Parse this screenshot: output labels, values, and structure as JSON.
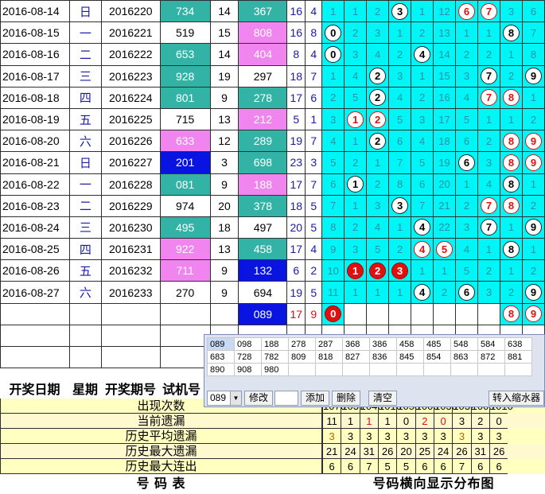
{
  "rows": [
    {
      "date": "2016-08-14",
      "week": "日",
      "issue": "2016220",
      "trial": "734",
      "trial_style": "teal",
      "span": "14",
      "prize": "367",
      "prize_style": "teal",
      "sum": "16",
      "pw": "4",
      "cells": [
        {
          "t": "1"
        },
        {
          "t": "1"
        },
        {
          "t": "2"
        },
        {
          "t": "3",
          "b": "black"
        },
        {
          "t": "1"
        },
        {
          "t": "12"
        },
        {
          "t": "6",
          "b": "red"
        },
        {
          "t": "7",
          "b": "red"
        },
        {
          "t": "3"
        },
        {
          "t": "6"
        }
      ]
    },
    {
      "date": "2016-08-15",
      "week": "一",
      "issue": "2016221",
      "trial": "519",
      "trial_style": "",
      "span": "15",
      "prize": "808",
      "prize_style": "pink",
      "sum": "16",
      "pw": "8",
      "cells": [
        {
          "t": "0",
          "b": "black"
        },
        {
          "t": "2"
        },
        {
          "t": "3"
        },
        {
          "t": "1"
        },
        {
          "t": "2"
        },
        {
          "t": "13"
        },
        {
          "t": "1"
        },
        {
          "t": "1"
        },
        {
          "t": "8",
          "b": "black"
        },
        {
          "t": "7"
        }
      ]
    },
    {
      "date": "2016-08-16",
      "week": "二",
      "issue": "2016222",
      "trial": "653",
      "trial_style": "teal",
      "span": "14",
      "prize": "404",
      "prize_style": "pink",
      "sum": "8",
      "pw": "4",
      "cells": [
        {
          "t": "0",
          "b": "black"
        },
        {
          "t": "3"
        },
        {
          "t": "4"
        },
        {
          "t": "2"
        },
        {
          "t": "4",
          "b": "black"
        },
        {
          "t": "14"
        },
        {
          "t": "2"
        },
        {
          "t": "2"
        },
        {
          "t": "1"
        },
        {
          "t": "8"
        }
      ]
    },
    {
      "date": "2016-08-17",
      "week": "三",
      "issue": "2016223",
      "trial": "928",
      "trial_style": "teal",
      "span": "19",
      "prize": "297",
      "prize_style": "",
      "sum": "18",
      "pw": "7",
      "cells": [
        {
          "t": "1"
        },
        {
          "t": "4"
        },
        {
          "t": "2",
          "b": "black"
        },
        {
          "t": "3"
        },
        {
          "t": "1"
        },
        {
          "t": "15"
        },
        {
          "t": "3"
        },
        {
          "t": "7",
          "b": "black"
        },
        {
          "t": "2"
        },
        {
          "t": "9",
          "b": "black"
        }
      ]
    },
    {
      "date": "2016-08-18",
      "week": "四",
      "issue": "2016224",
      "trial": "801",
      "trial_style": "teal",
      "span": "9",
      "prize": "278",
      "prize_style": "teal",
      "sum": "17",
      "pw": "6",
      "cells": [
        {
          "t": "2"
        },
        {
          "t": "5"
        },
        {
          "t": "2",
          "b": "black"
        },
        {
          "t": "4"
        },
        {
          "t": "2"
        },
        {
          "t": "16"
        },
        {
          "t": "4"
        },
        {
          "t": "7",
          "b": "red"
        },
        {
          "t": "8",
          "b": "red"
        },
        {
          "t": "1"
        }
      ]
    },
    {
      "date": "2016-08-19",
      "week": "五",
      "issue": "2016225",
      "trial": "715",
      "trial_style": "",
      "span": "13",
      "prize": "212",
      "prize_style": "pink",
      "sum": "5",
      "pw": "1",
      "cells": [
        {
          "t": "3"
        },
        {
          "t": "1",
          "b": "red"
        },
        {
          "t": "2",
          "b": "red"
        },
        {
          "t": "5"
        },
        {
          "t": "3"
        },
        {
          "t": "17"
        },
        {
          "t": "5"
        },
        {
          "t": "1"
        },
        {
          "t": "1"
        },
        {
          "t": "2"
        }
      ]
    },
    {
      "date": "2016-08-20",
      "week": "六",
      "issue": "2016226",
      "trial": "633",
      "trial_style": "pink",
      "span": "12",
      "prize": "289",
      "prize_style": "teal",
      "sum": "19",
      "pw": "7",
      "cells": [
        {
          "t": "4"
        },
        {
          "t": "1"
        },
        {
          "t": "2",
          "b": "black"
        },
        {
          "t": "6"
        },
        {
          "t": "4"
        },
        {
          "t": "18"
        },
        {
          "t": "6"
        },
        {
          "t": "2"
        },
        {
          "t": "8",
          "b": "red"
        },
        {
          "t": "9",
          "b": "red"
        }
      ]
    },
    {
      "date": "2016-08-21",
      "week": "日",
      "issue": "2016227",
      "trial": "201",
      "trial_style": "blue",
      "span": "3",
      "prize": "698",
      "prize_style": "teal",
      "sum": "23",
      "pw": "3",
      "cells": [
        {
          "t": "5"
        },
        {
          "t": "2"
        },
        {
          "t": "1"
        },
        {
          "t": "7"
        },
        {
          "t": "5"
        },
        {
          "t": "19"
        },
        {
          "t": "6",
          "b": "black"
        },
        {
          "t": "3"
        },
        {
          "t": "8",
          "b": "red"
        },
        {
          "t": "9",
          "b": "red"
        }
      ]
    },
    {
      "date": "2016-08-22",
      "week": "一",
      "issue": "2016228",
      "trial": "081",
      "trial_style": "teal",
      "span": "9",
      "prize": "188",
      "prize_style": "pink",
      "sum": "17",
      "pw": "7",
      "cells": [
        {
          "t": "6"
        },
        {
          "t": "1",
          "b": "black"
        },
        {
          "t": "2"
        },
        {
          "t": "8"
        },
        {
          "t": "6"
        },
        {
          "t": "20"
        },
        {
          "t": "1"
        },
        {
          "t": "4"
        },
        {
          "t": "8",
          "b": "black"
        },
        {
          "t": "1"
        }
      ]
    },
    {
      "date": "2016-08-23",
      "week": "二",
      "issue": "2016229",
      "trial": "974",
      "trial_style": "",
      "span": "20",
      "prize": "378",
      "prize_style": "teal",
      "sum": "18",
      "pw": "5",
      "cells": [
        {
          "t": "7"
        },
        {
          "t": "1"
        },
        {
          "t": "3"
        },
        {
          "t": "3",
          "b": "black"
        },
        {
          "t": "7"
        },
        {
          "t": "21"
        },
        {
          "t": "2"
        },
        {
          "t": "7",
          "b": "red"
        },
        {
          "t": "8",
          "b": "red"
        },
        {
          "t": "2"
        }
      ]
    },
    {
      "date": "2016-08-24",
      "week": "三",
      "issue": "2016230",
      "trial": "495",
      "trial_style": "teal",
      "span": "18",
      "prize": "497",
      "prize_style": "",
      "sum": "20",
      "pw": "5",
      "cells": [
        {
          "t": "8"
        },
        {
          "t": "2"
        },
        {
          "t": "4"
        },
        {
          "t": "1"
        },
        {
          "t": "4",
          "b": "black"
        },
        {
          "t": "22"
        },
        {
          "t": "3"
        },
        {
          "t": "7",
          "b": "black"
        },
        {
          "t": "1"
        },
        {
          "t": "9",
          "b": "black"
        }
      ]
    },
    {
      "date": "2016-08-25",
      "week": "四",
      "issue": "2016231",
      "trial": "922",
      "trial_style": "pink",
      "span": "13",
      "prize": "458",
      "prize_style": "teal",
      "sum": "17",
      "pw": "4",
      "cells": [
        {
          "t": "9"
        },
        {
          "t": "3"
        },
        {
          "t": "5"
        },
        {
          "t": "2"
        },
        {
          "t": "4",
          "b": "red"
        },
        {
          "t": "5",
          "b": "red"
        },
        {
          "t": "4"
        },
        {
          "t": "1"
        },
        {
          "t": "8",
          "b": "black"
        },
        {
          "t": "1"
        }
      ]
    },
    {
      "date": "2016-08-26",
      "week": "五",
      "issue": "2016232",
      "trial": "711",
      "trial_style": "pink",
      "span": "9",
      "prize": "132",
      "prize_style": "blue",
      "sum": "6",
      "pw": "2",
      "cells": [
        {
          "t": "10"
        },
        {
          "t": "1",
          "b": "fred"
        },
        {
          "t": "2",
          "b": "fred"
        },
        {
          "t": "3",
          "b": "fred"
        },
        {
          "t": "1"
        },
        {
          "t": "1"
        },
        {
          "t": "5"
        },
        {
          "t": "2"
        },
        {
          "t": "1"
        },
        {
          "t": "2"
        }
      ]
    },
    {
      "date": "2016-08-27",
      "week": "六",
      "issue": "2016233",
      "trial": "270",
      "trial_style": "",
      "span": "9",
      "prize": "694",
      "prize_style": "",
      "sum": "19",
      "pw": "5",
      "cells": [
        {
          "t": "11"
        },
        {
          "t": "1"
        },
        {
          "t": "1"
        },
        {
          "t": "1"
        },
        {
          "t": "4",
          "b": "black"
        },
        {
          "t": "2"
        },
        {
          "t": "6",
          "b": "black"
        },
        {
          "t": "3"
        },
        {
          "t": "2"
        },
        {
          "t": "9",
          "b": "black"
        }
      ]
    }
  ],
  "predict_row": {
    "prize": "089",
    "sum": "17",
    "pw": "9",
    "cells": [
      {
        "t": "0",
        "b": "fred"
      },
      {
        "t": ""
      },
      {
        "t": ""
      },
      {
        "t": ""
      },
      {
        "t": ""
      },
      {
        "t": ""
      },
      {
        "t": ""
      },
      {
        "t": ""
      },
      {
        "t": "8",
        "b": "red"
      },
      {
        "t": "9",
        "b": "red"
      }
    ]
  },
  "headers": {
    "date": "开奖日期",
    "week": "星期",
    "issue": "开奖期号",
    "trial": "试机号"
  },
  "popup": {
    "grid": [
      [
        "089",
        "098",
        "188",
        "278",
        "287",
        "368",
        "386",
        "458",
        "485",
        "548",
        "584",
        "638"
      ],
      [
        "683",
        "728",
        "782",
        "809",
        "818",
        "827",
        "836",
        "845",
        "854",
        "863",
        "872",
        "881"
      ],
      [
        "890",
        "908",
        "980",
        "",
        "",
        "",
        "",
        "",
        "",
        "",
        "",
        ""
      ]
    ],
    "select_value": "089",
    "buttons": {
      "modify": "修改",
      "add": "添加",
      "delete": "删除",
      "clear": "清空",
      "shrink": "转入缩水器"
    }
  },
  "stats": [
    {
      "label": "出现次数",
      "values": [
        "1070",
        "1037",
        "1040",
        "1016",
        "1058",
        "1000",
        "1030",
        "1032",
        "1005",
        "1010"
      ],
      "row_style": "y1"
    },
    {
      "label": "当前遗漏",
      "values": [
        "11",
        "1",
        "1",
        "1",
        "0",
        "2",
        "0",
        "3",
        "2",
        "0"
      ],
      "row_style": "y2",
      "colors": [
        "",
        "",
        "red",
        "",
        "",
        "red",
        "red",
        "",
        "",
        ""
      ]
    },
    {
      "label": "历史平均遗漏",
      "values": [
        "3",
        "3",
        "3",
        "3",
        "3",
        "3",
        "3",
        "3",
        "3",
        "3"
      ],
      "row_style": "y1",
      "colors": [
        "#c06000",
        "",
        "",
        "",
        "",
        "",
        "",
        "#c06000",
        "",
        ""
      ]
    },
    {
      "label": "历史最大遗漏",
      "values": [
        "21",
        "24",
        "31",
        "26",
        "20",
        "25",
        "24",
        "26",
        "31",
        "26"
      ],
      "row_style": "y2"
    },
    {
      "label": "历史最大连出",
      "values": [
        "6",
        "6",
        "7",
        "5",
        "5",
        "6",
        "6",
        "7",
        "6",
        "6"
      ],
      "row_style": "y1"
    }
  ],
  "footer": {
    "left": "号  码  表",
    "right": "号码横向显示分布图"
  },
  "colors": {
    "cyan": "#00f6f6",
    "teal": "#33b3a6",
    "pink": "#f085f0",
    "blue": "#0a14e0",
    "red": "#e01010"
  }
}
